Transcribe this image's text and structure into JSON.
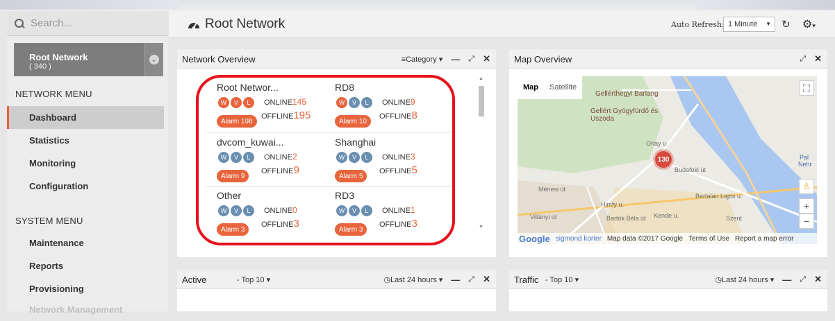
{
  "sidebar": {
    "search_placeholder": "Search...",
    "root": {
      "name": "Root Network",
      "count": "( 340 )"
    },
    "network_menu_title": "NETWORK MENU",
    "network_items": [
      "Dashboard",
      "Statistics",
      "Monitoring",
      "Configuration"
    ],
    "system_menu_title": "SYSTEM MENU",
    "system_items": [
      "Maintenance",
      "Reports",
      "Provisioning",
      "Network Management"
    ]
  },
  "header": {
    "title": "Root Network",
    "auto_refresh_label": "Auto Refresh:",
    "auto_refresh_value": "1 Minute"
  },
  "network_overview": {
    "title": "Network Overview",
    "category_label": "Category",
    "groups": [
      {
        "name": "Root Networ...",
        "online": "145",
        "offline": "195",
        "alarm": "Alarm 198",
        "active": true
      },
      {
        "name": "RD8",
        "online": "9",
        "offline": "8",
        "alarm": "Alarm 10",
        "active": true
      },
      {
        "name": "dvcom_kuwai...",
        "online": "2",
        "offline": "9",
        "alarm": "Alarm 9",
        "active": false
      },
      {
        "name": "Shanghai",
        "online": "3",
        "offline": "5",
        "alarm": "Alarm 5",
        "active": false
      },
      {
        "name": "Other",
        "online": "0",
        "offline": "3",
        "alarm": "Alarm 3",
        "active": false
      },
      {
        "name": "RD3",
        "online": "1",
        "offline": "3",
        "alarm": "Alarm 3",
        "active": false
      }
    ],
    "online_label": "ONLINE",
    "offline_label": "OFFLINE",
    "badges": [
      "W",
      "V",
      "L"
    ]
  },
  "map_overview": {
    "title": "Map Overview",
    "map_btn": "Map",
    "satellite_btn": "Satellite",
    "pois": [
      "Gellérthegyi Barlang",
      "Gellért Gyógyfürdő és Uszoda"
    ],
    "streets": [
      "Orlay u.",
      "Ménesi út",
      "Villányi út",
      "Bartók Béla út",
      "Bertalan Lajos u.",
      "Budafoki út",
      "Himfy u.",
      "Kende u.",
      "Szent"
    ],
    "cluster_count": "130",
    "footer": {
      "logo": "Google",
      "sub": "sigmond korter",
      "data": "Map data ©2017 Google",
      "terms": "Terms of Use",
      "report": "Report a map error"
    },
    "edge_labels": [
      "Pal",
      "Nehr"
    ]
  },
  "active_panel": {
    "title": "Active",
    "top": "- Top 10",
    "range": "Last 24 hours"
  },
  "traffic_panel": {
    "title": "Traffic",
    "top": "- Top 10",
    "range": "Last 24 hours"
  }
}
